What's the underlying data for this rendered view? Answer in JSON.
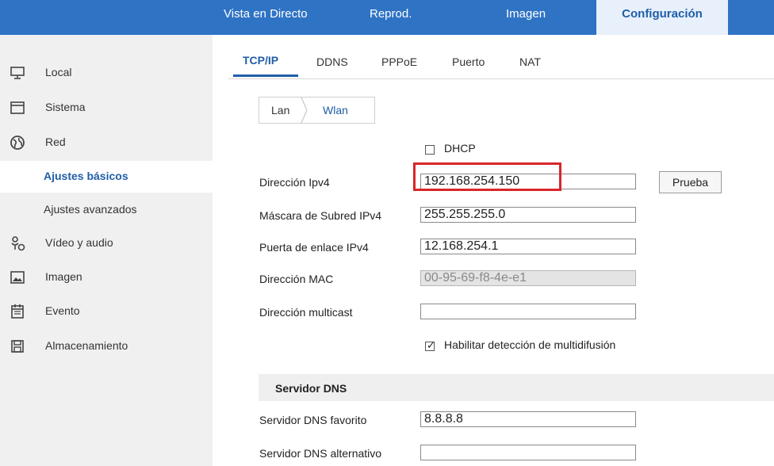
{
  "topnav": {
    "live": "Vista en Directo",
    "playback": "Reprod.",
    "image": "Imagen",
    "config": "Configuración"
  },
  "sidebar": {
    "items": [
      {
        "label": "Local",
        "icon": "monitor-icon"
      },
      {
        "label": "Sistema",
        "icon": "window-icon"
      },
      {
        "label": "Red",
        "icon": "globe-icon"
      },
      {
        "label": "Ajustes básicos"
      },
      {
        "label": "Ajustes avanzados"
      },
      {
        "label": "Vídeo y audio",
        "icon": "microphone-video-icon"
      },
      {
        "label": "Imagen",
        "icon": "picture-icon"
      },
      {
        "label": "Evento",
        "icon": "calendar-icon"
      },
      {
        "label": "Almacenamiento",
        "icon": "storage-icon"
      }
    ],
    "selected": "Ajustes básicos"
  },
  "tabs": [
    "TCP/IP",
    "DDNS",
    "PPPoE",
    "Puerto",
    "NAT"
  ],
  "subtabs": [
    "Lan",
    "Wlan"
  ],
  "form": {
    "dhcp_label": "DHCP",
    "dhcp_checked": false,
    "ipv4_label": "Dirección Ipv4",
    "ipv4_value": "192.168.254.150",
    "test_button": "Prueba",
    "mask_label": "Máscara de Subred IPv4",
    "mask_value": "255.255.255.0",
    "gateway_label": "Puerta de enlace IPv4",
    "gateway_value": "12.168.254.1",
    "mac_label": "Dirección MAC",
    "mac_value": "00-95-69-f8-4e-e1",
    "multicast_label": "Dirección multicast",
    "multicast_value": "",
    "multicast_discovery_label": "Habilitar detección de multidifusión",
    "multicast_discovery_checked": true
  },
  "dns": {
    "section_title": "Servidor DNS",
    "preferred_label": "Servidor DNS favorito",
    "preferred_value": "8.8.8.8",
    "alternate_label": "Servidor DNS alternativo",
    "alternate_value": ""
  },
  "colors": {
    "topbar": "#2f73c4",
    "accent": "#1f5ea8",
    "highlight": "#d9262a"
  }
}
